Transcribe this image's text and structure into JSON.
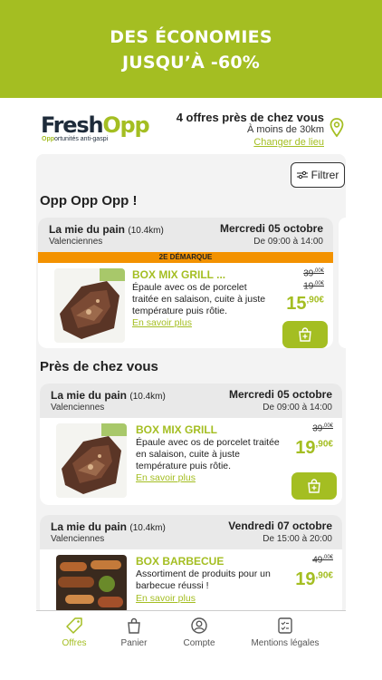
{
  "banner": {
    "line1": "DES ÉCONOMIES",
    "line2": "JUSQU’À -60%"
  },
  "brand": {
    "main": "Fresh",
    "accent": "Opp",
    "tag_accent": "Opp",
    "tag_rest": "ortunités anti-gaspi",
    "color": "#a4be22"
  },
  "location": {
    "title": "4 offres près de chez vous",
    "distance": "À moins de 30km",
    "change": "Changer de lieu"
  },
  "filter_label": "Filtrer",
  "sections": [
    {
      "title": "Opp Opp Opp !"
    },
    {
      "title": "Près de chez vous"
    }
  ],
  "cards": [
    {
      "shop": "La mie du pain",
      "km": "(10.4km)",
      "city": "Valenciennes",
      "date": "Mercredi 05 octobre",
      "hours": "De 09:00 à 14:00",
      "promo": "2E DÉMARQUE",
      "product": "BOX MIX GRILL ...",
      "desc1": "Épaule avec os de porcelet",
      "desc2": "traitée en salaison, cuite à juste",
      "desc3": "température puis rôtie.",
      "more": "En savoir plus",
      "old1": "39",
      "old1_dec": ",00€",
      "old2": "19",
      "old2_dec": ",00€",
      "price": "15",
      "price_dec": ",90€"
    },
    {
      "shop": "La mie du pain",
      "km": "(10.4km)",
      "city": "Valenciennes",
      "date": "Mercredi 05 octobre",
      "hours": "De 09:00 à 14:00",
      "product": "BOX MIX GRILL",
      "desc1": "Épaule avec os de porcelet traitée",
      "desc2": "en salaison, cuite à juste",
      "desc3": "température puis rôtie.",
      "more": "En savoir plus",
      "old1": "39",
      "old1_dec": ",00€",
      "price": "19",
      "price_dec": ",90€"
    },
    {
      "shop": "La mie du pain",
      "km": "(10.4km)",
      "city": "Valenciennes",
      "date": "Vendredi 07 octobre",
      "hours": "De 15:00 à 20:00",
      "product": "BOX BARBECUE",
      "desc1": "Assortiment de produits pour un",
      "desc2": "barbecue réussi !",
      "more": "En savoir plus",
      "old1": "49",
      "old1_dec": ",00€",
      "price": "19",
      "price_dec": ",90€"
    }
  ],
  "tabs": [
    {
      "label": "Offres",
      "icon": "tag-icon"
    },
    {
      "label": "Panier",
      "icon": "bag-icon"
    },
    {
      "label": "Compte",
      "icon": "account-icon"
    },
    {
      "label": "Mentions légales",
      "icon": "checklist-icon"
    }
  ]
}
